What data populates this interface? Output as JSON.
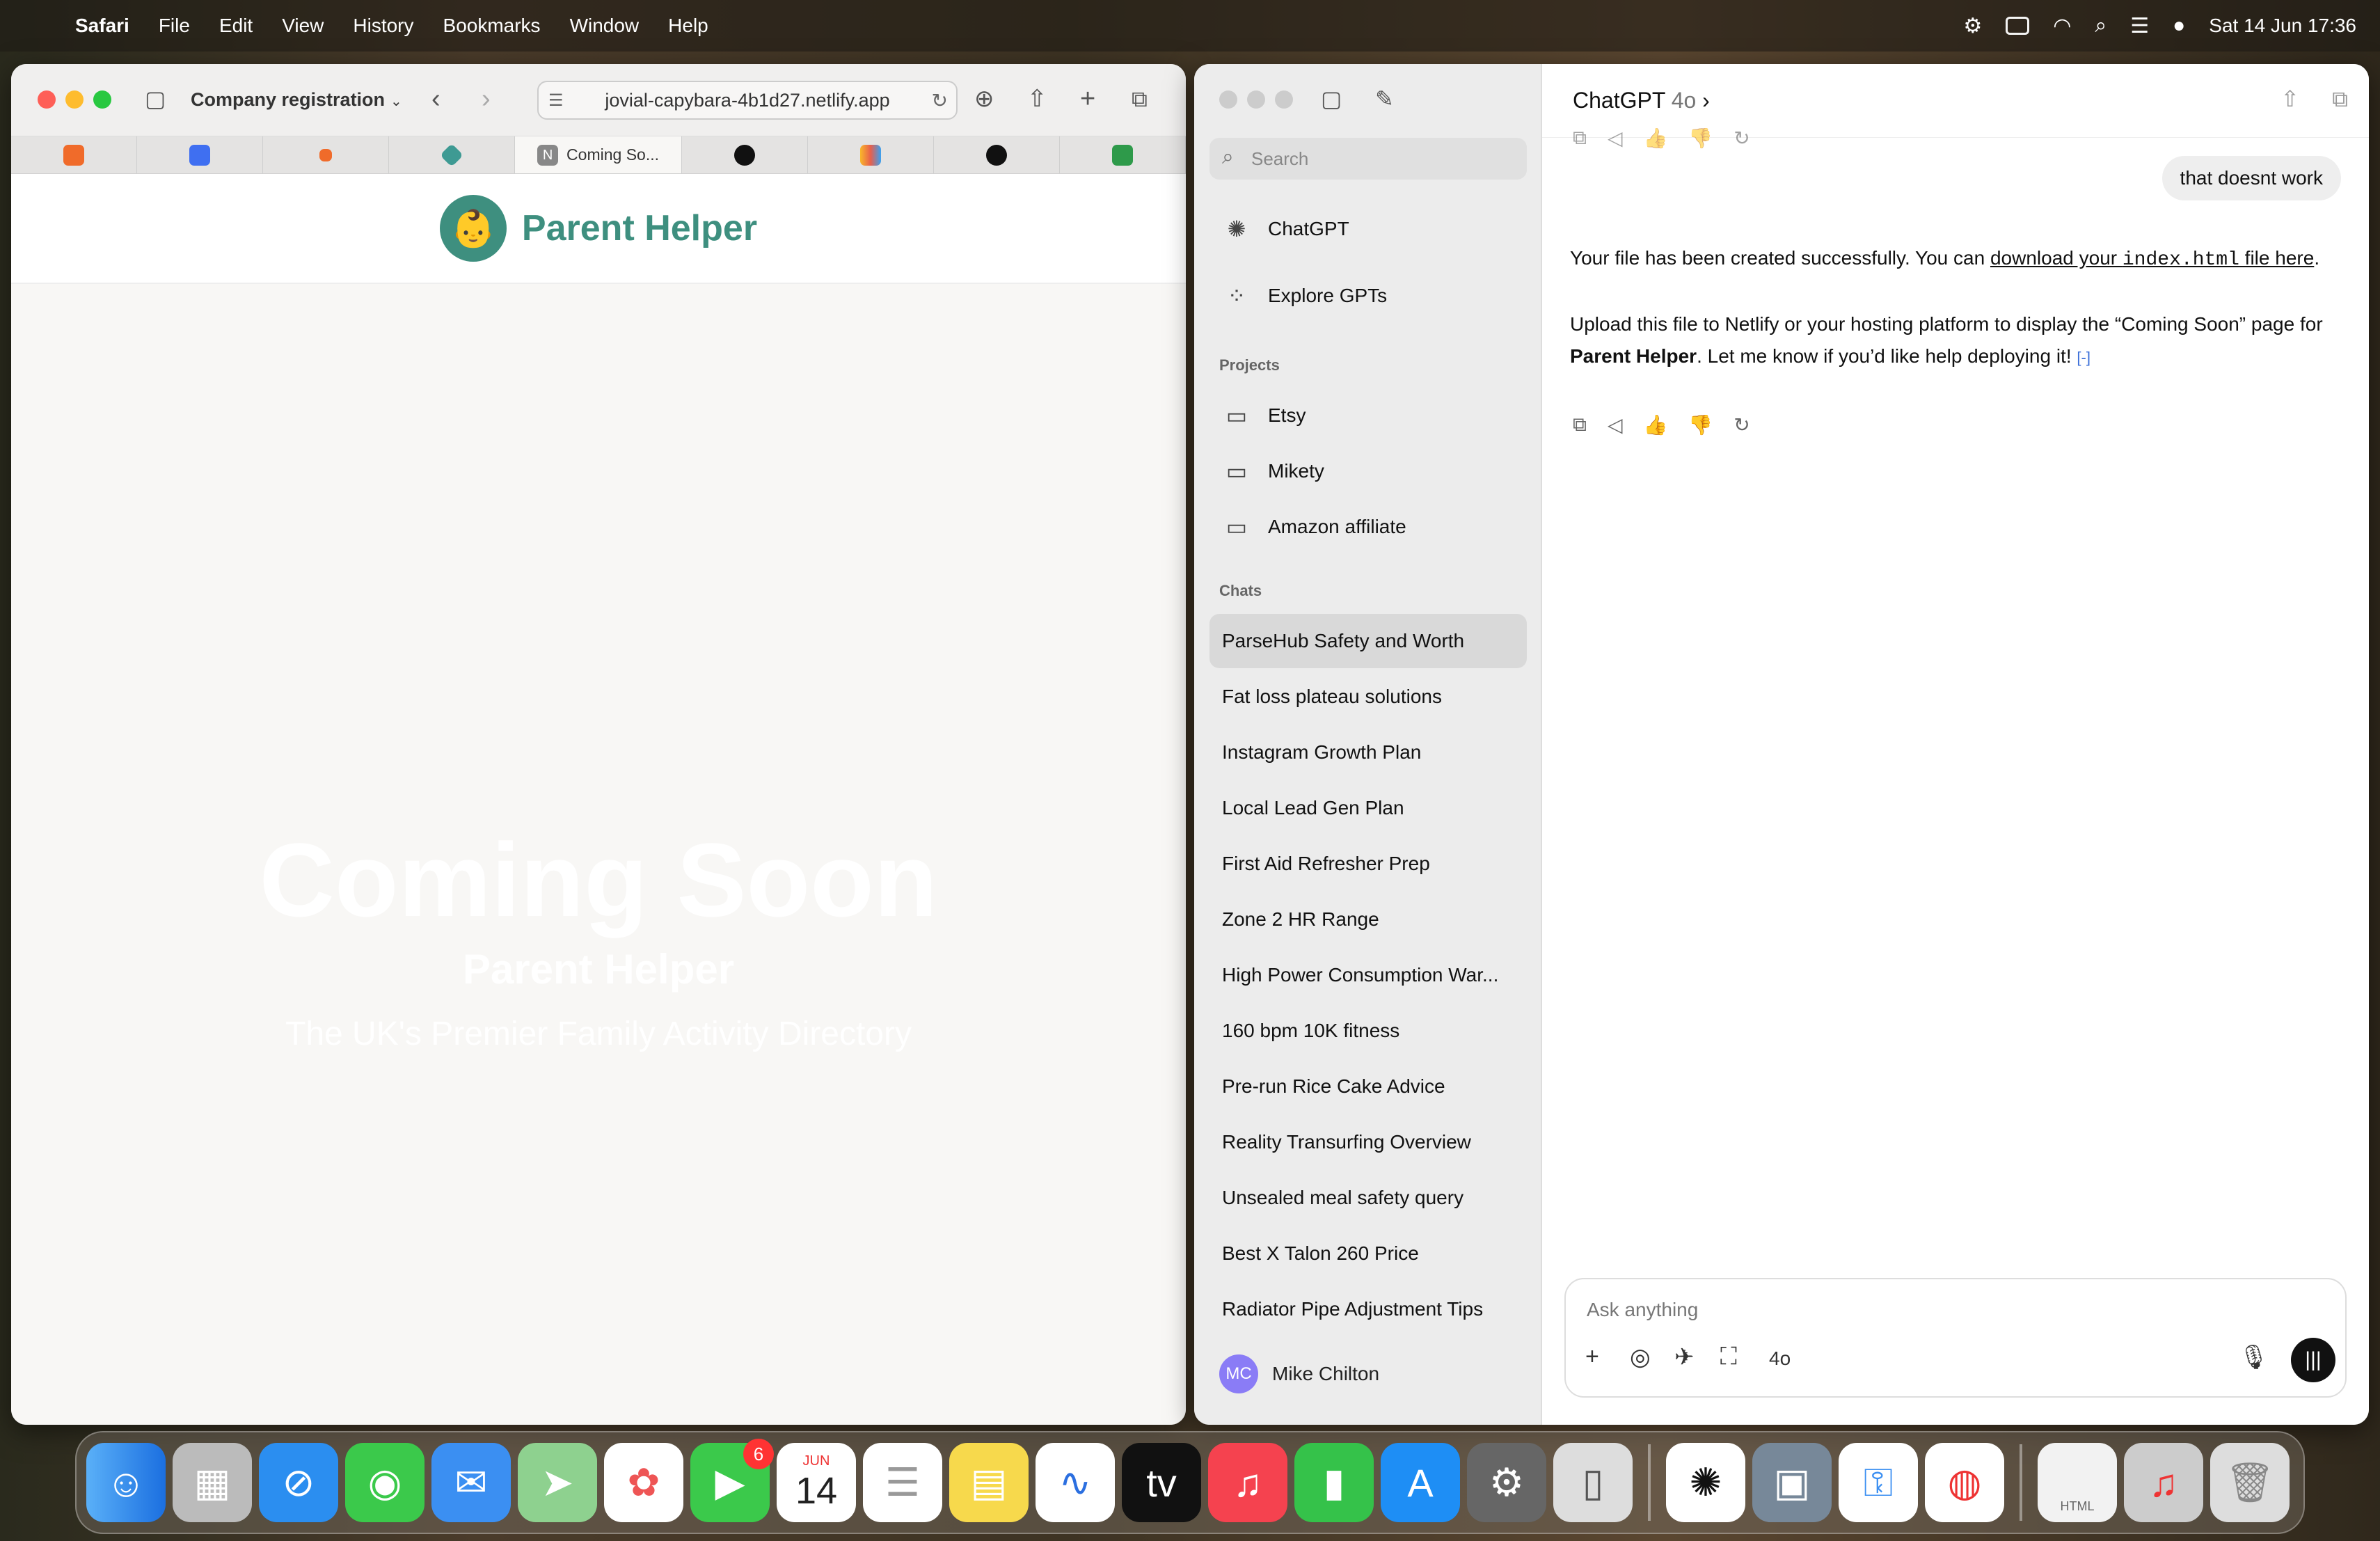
{
  "menubar": {
    "app": "Safari",
    "items": [
      "File",
      "Edit",
      "View",
      "History",
      "Bookmarks",
      "Window",
      "Help"
    ],
    "clock": "Sat 14 Jun  17:36"
  },
  "safari": {
    "window_title": "Company registration",
    "url": "jovial-capybara-4b1d27.netlify.app",
    "active_tab": "Coming So...",
    "tab_colors": [
      "#f06b2a",
      "#3f6ff1",
      "#f06b2a",
      "#3e9a93",
      "#777",
      "#111",
      "#e85f4c",
      "#111",
      "#2e9a4a"
    ]
  },
  "site": {
    "logo_emoji": "👶",
    "brand": "Parent Helper",
    "headline": "Coming Soon",
    "subheadline": "Parent Helper",
    "tagline": "The UK's Premier Family Activity Directory"
  },
  "chatgpt": {
    "model_name": "ChatGPT",
    "model_version": "4o",
    "search_placeholder": "Search",
    "nav": {
      "chatgpt": "ChatGPT",
      "explore": "Explore GPTs"
    },
    "projects_heading": "Projects",
    "projects": [
      "Etsy",
      "Mikety",
      "Amazon affiliate"
    ],
    "chats_heading": "Chats",
    "chats": [
      "ParseHub Safety and Worth",
      "Fat loss plateau solutions",
      "Instagram Growth Plan",
      "Local Lead Gen Plan",
      "First Aid Refresher Prep",
      "Zone 2 HR Range",
      "High Power Consumption War...",
      "160 bpm 10K fitness",
      "Pre-run Rice Cake Advice",
      "Reality Transurfing Overview",
      "Unsealed meal safety query",
      "Best X Talon 260 Price",
      "Radiator Pipe Adjustment Tips"
    ],
    "user": {
      "initials": "MC",
      "name": "Mike Chilton"
    },
    "user_message": "that doesnt work",
    "reply": {
      "p1_a": "Your file has been created successfully. You can ",
      "link1": "download your ",
      "code": "index.html",
      "link2": " file here",
      "p1_end": ".",
      "p2_a": "Upload this file to Netlify or your hosting platform to display the “Coming Soon” page for ",
      "p2_bold": "Parent Helper",
      "p2_b": ". Let me know if you’d like help deploying it! ",
      "cite": "[-]"
    },
    "composer_placeholder": "Ask anything",
    "composer_model": "4o"
  },
  "dock": {
    "facetime_badge": "6",
    "calendar_month": "JUN",
    "calendar_day": "14",
    "html_file_label": "HTML"
  }
}
